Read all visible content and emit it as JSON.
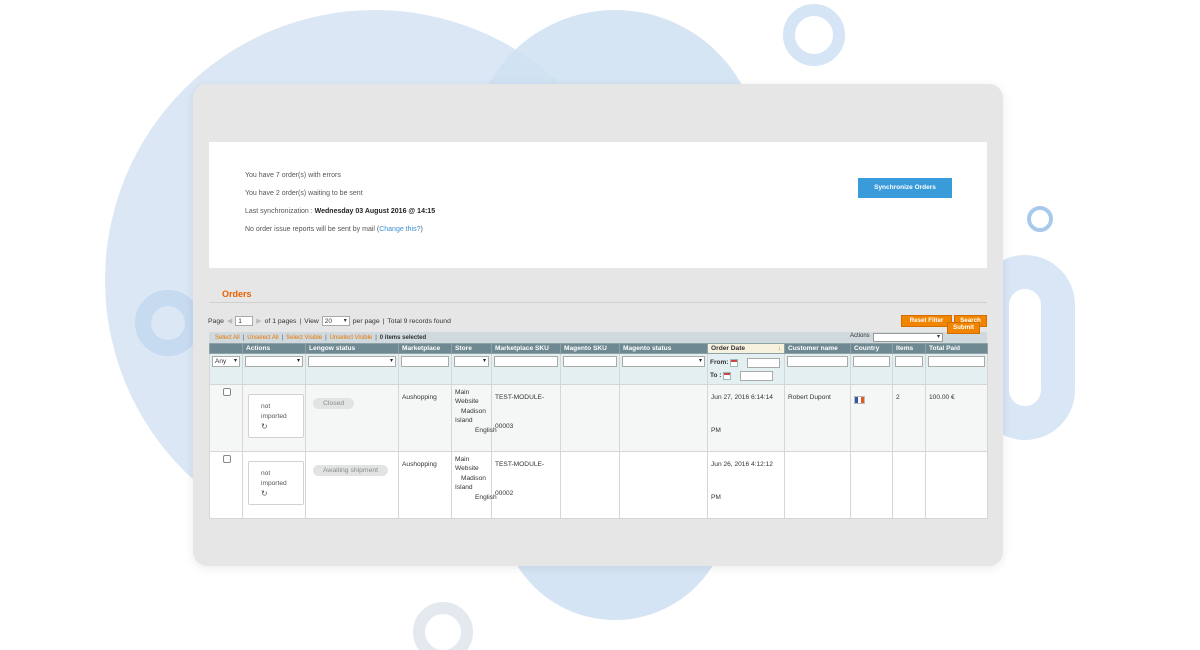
{
  "info": {
    "errors_text": "You have 7 order(s) with errors",
    "waiting_text": "You have 2 order(s) waiting to be sent",
    "last_sync_label": "Last synchronization : ",
    "last_sync_value": "Wednesday 03 August 2016 @ 14:15",
    "mail_text": "No order issue reports will be sent by mail (",
    "mail_link": "Change this?",
    "mail_close": ")",
    "sync_button": "Synchronize Orders"
  },
  "orders": {
    "title": "Orders",
    "pager": {
      "page_label": "Page",
      "page_value": "1",
      "of_pages": "of 1 pages",
      "sep1": "|",
      "view_label": "View",
      "per_page_value": "20",
      "per_page_label": "per page",
      "sep2": "|",
      "total": "Total 9 records found"
    },
    "reset_filter": "Reset Filter",
    "search": "Search",
    "mass": {
      "select_all": "Select All",
      "unselect_all": "Unselect All",
      "select_visible": "Select Visible",
      "unselect_visible": "Unselect Visible",
      "sep": "|",
      "selected": "0 items selected",
      "actions_label": "Actions",
      "submit": "Submit"
    },
    "columns": [
      "",
      "Actions",
      "Lengow status",
      "Marketplace",
      "Store",
      "Marketplace SKU",
      "Magento SKU",
      "Magento status",
      "Order Date",
      "Customer name",
      "Country",
      "Items",
      "Total Paid"
    ],
    "sort_indicator": "↓",
    "filters": {
      "any": "Any",
      "from_label": "From:",
      "to_label": "To :"
    },
    "rows": [
      {
        "action_line1": "not",
        "action_line2": "imported",
        "action_icon": "↻",
        "status": "Closed",
        "marketplace": "Aushopping",
        "store_l1": "Main",
        "store_l2": "Website",
        "store_l3": "Madison",
        "store_l4": "Island",
        "store_l5": "English",
        "sku_l1": "TEST-MODULE-",
        "sku_l2": "00003",
        "date_l1": "Jun 27, 2016 6:14:14",
        "date_l2": "PM",
        "customer": "Robert Dupont",
        "country_icon": "france-flag-icon",
        "items": "2",
        "total": "100.00 €"
      },
      {
        "action_line1": "not",
        "action_line2": "imported",
        "action_icon": "↻",
        "status": "Awaiting shipment",
        "marketplace": "Aushopping",
        "store_l1": "Main",
        "store_l2": "Website",
        "store_l3": "Madison",
        "store_l4": "Island",
        "store_l5": "English",
        "sku_l1": "TEST-MODULE-",
        "sku_l2": "00002",
        "date_l1": "Jun 26, 2016 4:12:12",
        "date_l2": "PM"
      }
    ]
  },
  "colors": {
    "accent_orange": "#eb5e00",
    "button_blue": "#3a9bdb",
    "header_bg": "#6f8992"
  }
}
